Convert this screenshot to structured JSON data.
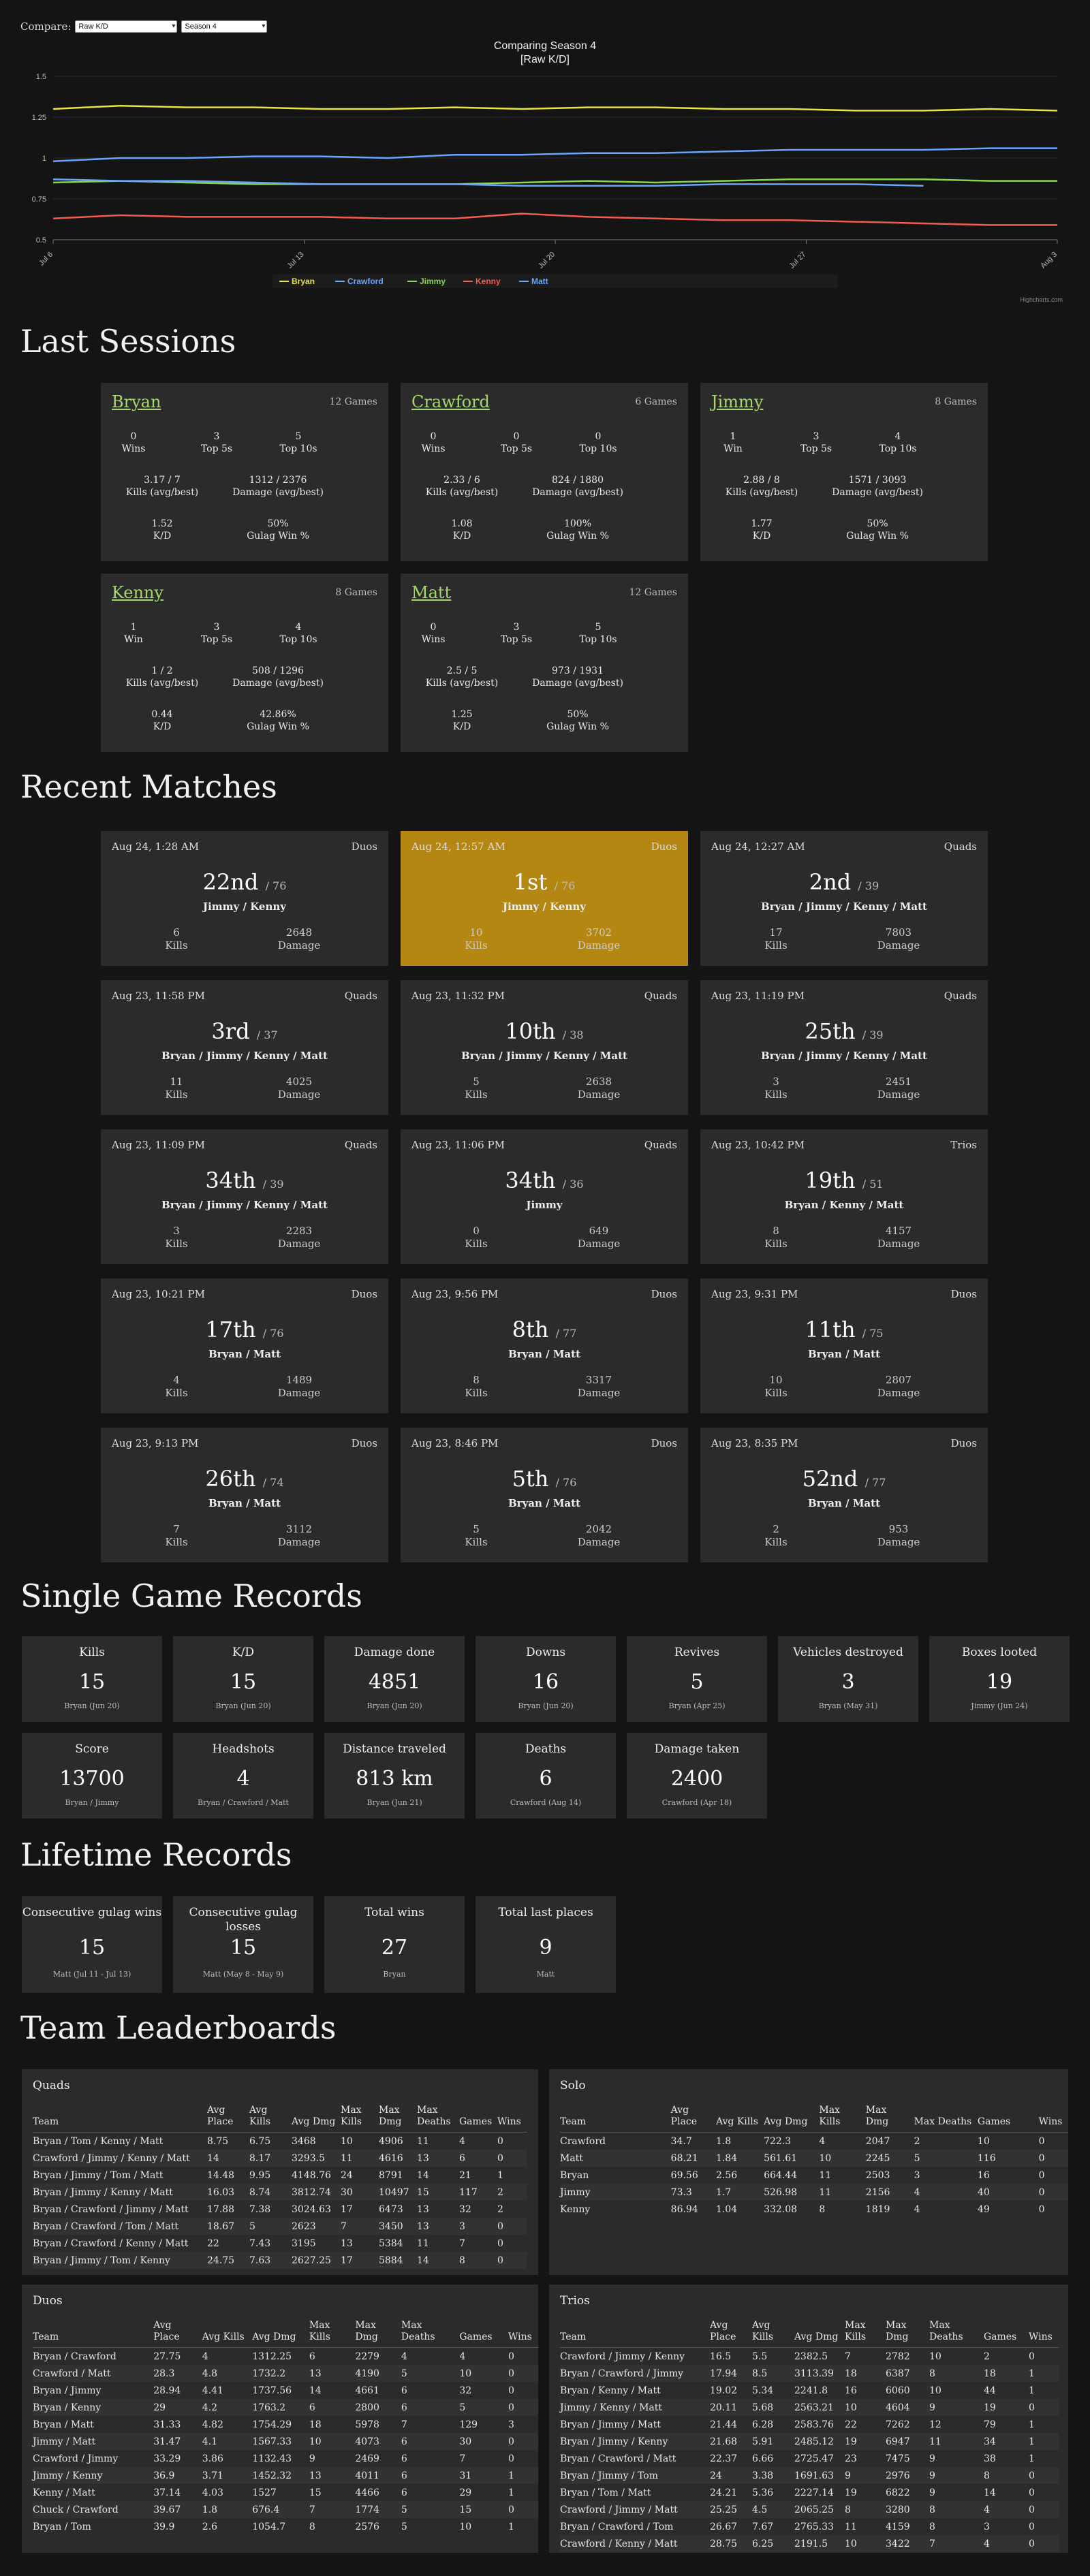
{
  "compare": {
    "label": "Compare:",
    "metric": "Raw K/D",
    "season": "Season 4"
  },
  "chart_data": {
    "type": "line",
    "title": "Comparing Season 4",
    "subtitle": "[Raw K/D]",
    "ylim": [
      0.5,
      1.5
    ],
    "yticks": [
      "0.5",
      "0.75",
      "1",
      "1.25",
      "1.5"
    ],
    "xticks": [
      "Jul 6",
      "Jul 13",
      "Jul 20",
      "Jul 27",
      "Aug 3"
    ],
    "credits": "Highcharts.com",
    "series": [
      {
        "name": "Bryan",
        "color": "#e8e443",
        "values": [
          1.3,
          1.32,
          1.31,
          1.31,
          1.3,
          1.3,
          1.31,
          1.3,
          1.31,
          1.31,
          1.3,
          1.3,
          1.29,
          1.29,
          1.3,
          1.29
        ]
      },
      {
        "name": "Crawford",
        "color": "#69a5ff",
        "values": [
          0.98,
          1.0,
          1.0,
          1.01,
          1.01,
          1.0,
          1.02,
          1.02,
          1.03,
          1.03,
          1.04,
          1.05,
          1.05,
          1.05,
          1.06,
          1.06
        ]
      },
      {
        "name": "Jimmy",
        "color": "#87d44d",
        "values": [
          0.85,
          0.86,
          0.85,
          0.84,
          0.84,
          0.84,
          0.84,
          0.85,
          0.86,
          0.85,
          0.86,
          0.87,
          0.87,
          0.87,
          0.86,
          0.86
        ]
      },
      {
        "name": "Kenny",
        "color": "#f25c4e",
        "values": [
          0.63,
          0.65,
          0.64,
          0.64,
          0.64,
          0.63,
          0.63,
          0.66,
          0.64,
          0.63,
          0.62,
          0.62,
          0.61,
          0.6,
          0.59,
          0.59
        ]
      },
      {
        "name": "Matt",
        "color": "#69a5ff",
        "values": [
          0.87,
          0.86,
          0.86,
          0.85,
          0.84,
          0.84,
          0.84,
          0.83,
          0.83,
          0.83,
          0.84,
          0.84,
          0.84,
          0.83,
          null,
          null
        ]
      }
    ]
  },
  "sections": {
    "last_sessions": "Last Sessions",
    "recent_matches": "Recent Matches",
    "single_records": "Single Game Records",
    "lifetime_records": "Lifetime Records",
    "leaderboards": "Team Leaderboards"
  },
  "sessions": [
    {
      "name": "Bryan",
      "games": "12 Games",
      "wins": "0",
      "wins_label": "Wins",
      "top5": "3",
      "top10": "5",
      "kills": "3.17 / 7",
      "damage": "1312 / 2376",
      "kd": "1.52",
      "gulag": "50%"
    },
    {
      "name": "Crawford",
      "games": "6 Games",
      "wins": "0",
      "wins_label": "Wins",
      "top5": "0",
      "top10": "0",
      "kills": "2.33 / 6",
      "damage": "824 / 1880",
      "kd": "1.08",
      "gulag": "100%"
    },
    {
      "name": "Jimmy",
      "games": "8 Games",
      "wins": "1",
      "wins_label": "Win",
      "top5": "3",
      "top10": "4",
      "kills": "2.88 / 8",
      "damage": "1571 / 3093",
      "kd": "1.77",
      "gulag": "50%"
    },
    {
      "name": "Kenny",
      "games": "8 Games",
      "wins": "1",
      "wins_label": "Win",
      "top5": "3",
      "top10": "4",
      "kills": "1 / 2",
      "damage": "508 / 1296",
      "kd": "0.44",
      "gulag": "42.86%"
    },
    {
      "name": "Matt",
      "games": "12 Games",
      "wins": "0",
      "wins_label": "Wins",
      "top5": "3",
      "top10": "5",
      "kills": "2.5 / 5",
      "damage": "973 / 1931",
      "kd": "1.25",
      "gulag": "50%"
    }
  ],
  "session_labels": {
    "top5": "Top 5s",
    "top10": "Top 10s",
    "kills": "Kills (avg/best)",
    "damage": "Damage (avg/best)",
    "kd": "K/D",
    "gulag": "Gulag Win %"
  },
  "match_labels": {
    "kills": "Kills",
    "damage": "Damage"
  },
  "matches": [
    {
      "date": "Aug 24, 1:28 AM",
      "mode": "Duos",
      "place": "22nd",
      "of": "/ 76",
      "team": "Jimmy / Kenny",
      "kills": "6",
      "damage": "2648",
      "win": false
    },
    {
      "date": "Aug 24, 12:57 AM",
      "mode": "Duos",
      "place": "1st",
      "of": "/ 76",
      "team": "Jimmy / Kenny",
      "kills": "10",
      "damage": "3702",
      "win": true
    },
    {
      "date": "Aug 24, 12:27 AM",
      "mode": "Quads",
      "place": "2nd",
      "of": "/ 39",
      "team": "Bryan / Jimmy / Kenny / Matt",
      "kills": "17",
      "damage": "7803",
      "win": false
    },
    {
      "date": "Aug 23, 11:58 PM",
      "mode": "Quads",
      "place": "3rd",
      "of": "/ 37",
      "team": "Bryan / Jimmy / Kenny / Matt",
      "kills": "11",
      "damage": "4025",
      "win": false
    },
    {
      "date": "Aug 23, 11:32 PM",
      "mode": "Quads",
      "place": "10th",
      "of": "/ 38",
      "team": "Bryan / Jimmy / Kenny / Matt",
      "kills": "5",
      "damage": "2638",
      "win": false
    },
    {
      "date": "Aug 23, 11:19 PM",
      "mode": "Quads",
      "place": "25th",
      "of": "/ 39",
      "team": "Bryan / Jimmy / Kenny / Matt",
      "kills": "3",
      "damage": "2451",
      "win": false
    },
    {
      "date": "Aug 23, 11:09 PM",
      "mode": "Quads",
      "place": "34th",
      "of": "/ 39",
      "team": "Bryan / Jimmy / Kenny / Matt",
      "kills": "3",
      "damage": "2283",
      "win": false
    },
    {
      "date": "Aug 23, 11:06 PM",
      "mode": "Quads",
      "place": "34th",
      "of": "/ 36",
      "team": "Jimmy",
      "kills": "0",
      "damage": "649",
      "win": false
    },
    {
      "date": "Aug 23, 10:42 PM",
      "mode": "Trios",
      "place": "19th",
      "of": "/ 51",
      "team": "Bryan / Kenny / Matt",
      "kills": "8",
      "damage": "4157",
      "win": false
    },
    {
      "date": "Aug 23, 10:21 PM",
      "mode": "Duos",
      "place": "17th",
      "of": "/ 76",
      "team": "Bryan / Matt",
      "kills": "4",
      "damage": "1489",
      "win": false
    },
    {
      "date": "Aug 23, 9:56 PM",
      "mode": "Duos",
      "place": "8th",
      "of": "/ 77",
      "team": "Bryan / Matt",
      "kills": "8",
      "damage": "3317",
      "win": false
    },
    {
      "date": "Aug 23, 9:31 PM",
      "mode": "Duos",
      "place": "11th",
      "of": "/ 75",
      "team": "Bryan / Matt",
      "kills": "10",
      "damage": "2807",
      "win": false
    },
    {
      "date": "Aug 23, 9:13 PM",
      "mode": "Duos",
      "place": "26th",
      "of": "/ 74",
      "team": "Bryan / Matt",
      "kills": "7",
      "damage": "3112",
      "win": false
    },
    {
      "date": "Aug 23, 8:46 PM",
      "mode": "Duos",
      "place": "5th",
      "of": "/ 76",
      "team": "Bryan / Matt",
      "kills": "5",
      "damage": "2042",
      "win": false
    },
    {
      "date": "Aug 23, 8:35 PM",
      "mode": "Duos",
      "place": "52nd",
      "of": "/ 77",
      "team": "Bryan / Matt",
      "kills": "2",
      "damage": "953",
      "win": false
    }
  ],
  "single_records": [
    {
      "title": "Kills",
      "value": "15",
      "who": "Bryan (Jun 20)"
    },
    {
      "title": "K/D",
      "value": "15",
      "who": "Bryan (Jun 20)"
    },
    {
      "title": "Damage done",
      "value": "4851",
      "who": "Bryan (Jun 20)"
    },
    {
      "title": "Downs",
      "value": "16",
      "who": "Bryan (Jun 20)"
    },
    {
      "title": "Revives",
      "value": "5",
      "who": "Bryan (Apr 25)"
    },
    {
      "title": "Vehicles destroyed",
      "value": "3",
      "who": "Bryan (May 31)"
    },
    {
      "title": "Boxes looted",
      "value": "19",
      "who": "Jimmy (Jun 24)"
    },
    {
      "title": "Score",
      "value": "13700",
      "who": "Bryan / Jimmy"
    },
    {
      "title": "Headshots",
      "value": "4",
      "who": "Bryan / Crawford / Matt"
    },
    {
      "title": "Distance traveled",
      "value": "813 km",
      "who": "Bryan (Jun 21)"
    },
    {
      "title": "Deaths",
      "value": "6",
      "who": "Crawford (Aug 14)"
    },
    {
      "title": "Damage taken",
      "value": "2400",
      "who": "Crawford (Apr 18)"
    }
  ],
  "lifetime_records": [
    {
      "title": "Consecutive gulag wins",
      "value": "15",
      "who": "Matt (Jul 11 - Jul 13)"
    },
    {
      "title": "Consecutive gulag losses",
      "value": "15",
      "who": "Matt (May 8 - May 9)"
    },
    {
      "title": "Total wins",
      "value": "27",
      "who": "Bryan"
    },
    {
      "title": "Total last places",
      "value": "9",
      "who": "Matt"
    }
  ],
  "leaderboards": [
    {
      "title": "Quads",
      "headers": [
        "Team",
        "Avg Place",
        "Avg Kills",
        "Avg Dmg",
        "Max Kills",
        "Max Dmg",
        "Max Deaths",
        "Games",
        "Wins"
      ],
      "rows": [
        [
          "Bryan / Tom / Kenny / Matt",
          "8.75",
          "6.75",
          "3468",
          "10",
          "4906",
          "11",
          "4",
          "0"
        ],
        [
          "Crawford / Jimmy / Kenny / Matt",
          "14",
          "8.17",
          "3293.5",
          "11",
          "4616",
          "13",
          "6",
          "0"
        ],
        [
          "Bryan / Jimmy / Tom / Matt",
          "14.48",
          "9.95",
          "4148.76",
          "24",
          "8791",
          "14",
          "21",
          "1"
        ],
        [
          "Bryan / Jimmy / Kenny / Matt",
          "16.03",
          "8.74",
          "3812.74",
          "30",
          "10497",
          "15",
          "117",
          "2"
        ],
        [
          "Bryan / Crawford / Jimmy / Matt",
          "17.88",
          "7.38",
          "3024.63",
          "17",
          "6473",
          "13",
          "32",
          "2"
        ],
        [
          "Bryan / Crawford / Tom / Matt",
          "18.67",
          "5",
          "2623",
          "7",
          "3450",
          "13",
          "3",
          "0"
        ],
        [
          "Bryan / Crawford / Kenny / Matt",
          "22",
          "7.43",
          "3195",
          "13",
          "5384",
          "11",
          "7",
          "0"
        ],
        [
          "Bryan / Jimmy / Tom / Kenny",
          "24.75",
          "7.63",
          "2627.25",
          "17",
          "5884",
          "14",
          "8",
          "0"
        ]
      ]
    },
    {
      "title": "Solo",
      "headers": [
        "Team",
        "Avg Place",
        "Avg Kills",
        "Avg Dmg",
        "Max Kills",
        "Max Dmg",
        "Max Deaths",
        "Games",
        "Wins"
      ],
      "rows": [
        [
          "Crawford",
          "34.7",
          "1.8",
          "722.3",
          "4",
          "2047",
          "2",
          "10",
          "0"
        ],
        [
          "Matt",
          "68.21",
          "1.84",
          "561.61",
          "10",
          "2245",
          "5",
          "116",
          "0"
        ],
        [
          "Bryan",
          "69.56",
          "2.56",
          "664.44",
          "11",
          "2503",
          "3",
          "16",
          "0"
        ],
        [
          "Jimmy",
          "73.3",
          "1.7",
          "526.98",
          "11",
          "2156",
          "4",
          "40",
          "0"
        ],
        [
          "Kenny",
          "86.94",
          "1.04",
          "332.08",
          "8",
          "1819",
          "4",
          "49",
          "0"
        ]
      ]
    },
    {
      "title": "Duos",
      "headers": [
        "Team",
        "Avg Place",
        "Avg Kills",
        "Avg Dmg",
        "Max Kills",
        "Max Dmg",
        "Max Deaths",
        "Games",
        "Wins"
      ],
      "rows": [
        [
          "Bryan / Crawford",
          "27.75",
          "4",
          "1312.25",
          "6",
          "2279",
          "4",
          "4",
          "0"
        ],
        [
          "Crawford / Matt",
          "28.3",
          "4.8",
          "1732.2",
          "13",
          "4190",
          "5",
          "10",
          "0"
        ],
        [
          "Bryan / Jimmy",
          "28.94",
          "4.41",
          "1737.56",
          "14",
          "4661",
          "6",
          "32",
          "0"
        ],
        [
          "Bryan / Kenny",
          "29",
          "4.2",
          "1763.2",
          "6",
          "2800",
          "6",
          "5",
          "0"
        ],
        [
          "Bryan / Matt",
          "31.33",
          "4.82",
          "1754.29",
          "18",
          "5978",
          "7",
          "129",
          "3"
        ],
        [
          "Jimmy / Matt",
          "31.47",
          "4.1",
          "1567.33",
          "10",
          "4073",
          "6",
          "30",
          "0"
        ],
        [
          "Crawford / Jimmy",
          "33.29",
          "3.86",
          "1132.43",
          "9",
          "2469",
          "6",
          "7",
          "0"
        ],
        [
          "Jimmy / Kenny",
          "36.9",
          "3.71",
          "1452.32",
          "13",
          "4011",
          "6",
          "31",
          "1"
        ],
        [
          "Kenny / Matt",
          "37.14",
          "4.03",
          "1527",
          "15",
          "4466",
          "6",
          "29",
          "1"
        ],
        [
          "Chuck / Crawford",
          "39.67",
          "1.8",
          "676.4",
          "7",
          "1774",
          "5",
          "15",
          "0"
        ],
        [
          "Bryan / Tom",
          "39.9",
          "2.6",
          "1054.7",
          "8",
          "2576",
          "5",
          "10",
          "1"
        ]
      ]
    },
    {
      "title": "Trios",
      "headers": [
        "Team",
        "Avg Place",
        "Avg Kills",
        "Avg Dmg",
        "Max Kills",
        "Max Dmg",
        "Max Deaths",
        "Games",
        "Wins"
      ],
      "rows": [
        [
          "Crawford / Jimmy / Kenny",
          "16.5",
          "5.5",
          "2382.5",
          "7",
          "2782",
          "10",
          "2",
          "0"
        ],
        [
          "Bryan / Crawford / Jimmy",
          "17.94",
          "8.5",
          "3113.39",
          "18",
          "6387",
          "8",
          "18",
          "1"
        ],
        [
          "Bryan / Kenny / Matt",
          "19.02",
          "5.34",
          "2241.8",
          "16",
          "6060",
          "10",
          "44",
          "1"
        ],
        [
          "Jimmy / Kenny / Matt",
          "20.11",
          "5.68",
          "2563.21",
          "10",
          "4604",
          "9",
          "19",
          "0"
        ],
        [
          "Bryan / Jimmy / Matt",
          "21.44",
          "6.28",
          "2583.76",
          "22",
          "7262",
          "12",
          "79",
          "1"
        ],
        [
          "Bryan / Jimmy / Kenny",
          "21.68",
          "5.91",
          "2485.12",
          "19",
          "6947",
          "11",
          "34",
          "1"
        ],
        [
          "Bryan / Crawford / Matt",
          "22.37",
          "6.66",
          "2725.47",
          "23",
          "7475",
          "9",
          "38",
          "1"
        ],
        [
          "Bryan / Jimmy / Tom",
          "24",
          "3.38",
          "1691.63",
          "9",
          "2976",
          "9",
          "8",
          "0"
        ],
        [
          "Bryan / Tom / Matt",
          "24.21",
          "5.36",
          "2227.14",
          "19",
          "6822",
          "9",
          "14",
          "0"
        ],
        [
          "Crawford / Jimmy / Matt",
          "25.25",
          "4.5",
          "2065.25",
          "8",
          "3280",
          "8",
          "4",
          "0"
        ],
        [
          "Bryan / Crawford / Tom",
          "26.67",
          "7.67",
          "2765.33",
          "11",
          "4159",
          "8",
          "3",
          "0"
        ],
        [
          "Crawford / Kenny / Matt",
          "28.75",
          "6.25",
          "2191.5",
          "10",
          "3422",
          "7",
          "4",
          "0"
        ]
      ]
    }
  ],
  "colors": {
    "accent": "#a6d76b",
    "win": "#b38711",
    "card": "#2b2b2b",
    "background": "#141414"
  }
}
